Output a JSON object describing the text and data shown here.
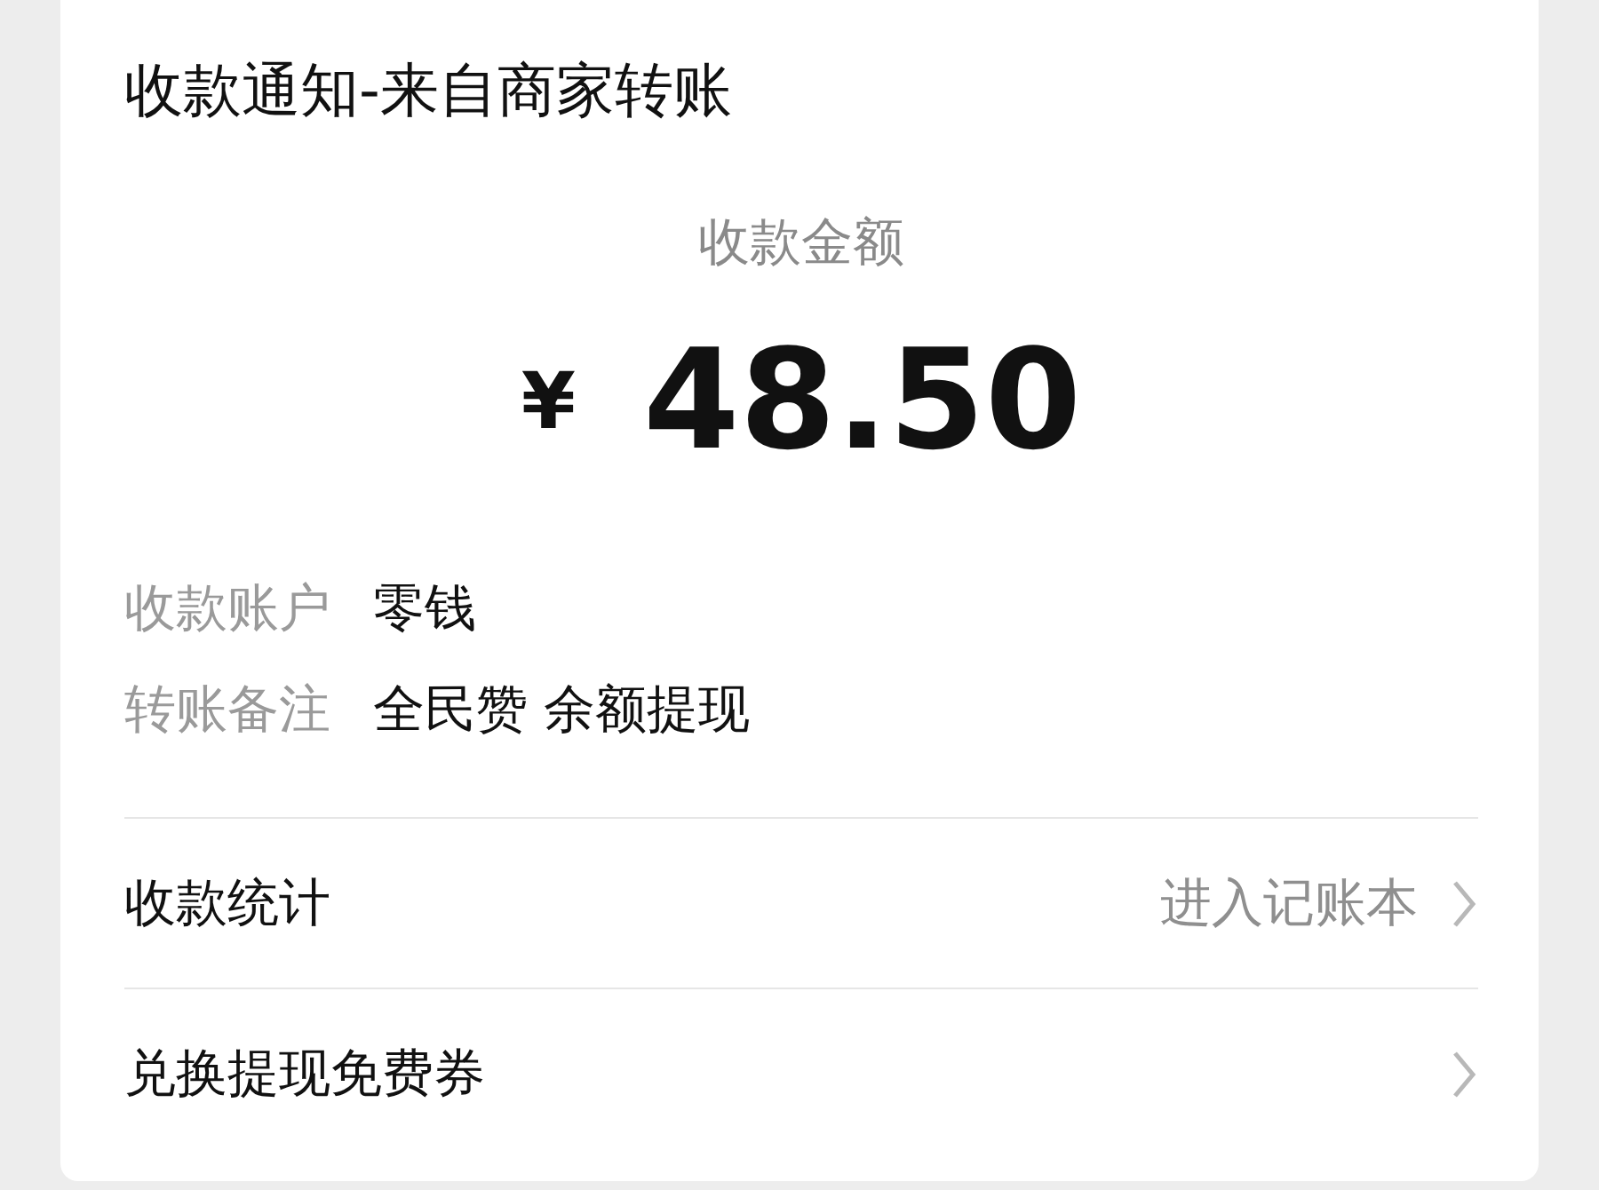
{
  "title": "收款通知-来自商家转账",
  "amount_label": "收款金额",
  "amount": {
    "currency": "¥",
    "value": "48.50"
  },
  "details": [
    {
      "label": "收款账户",
      "value": "零钱"
    },
    {
      "label": "转账备注",
      "value": "全民赞 余额提现"
    }
  ],
  "links": [
    {
      "label": "收款统计",
      "hint": "进入记账本"
    },
    {
      "label": "兑换提现免费券"
    }
  ]
}
